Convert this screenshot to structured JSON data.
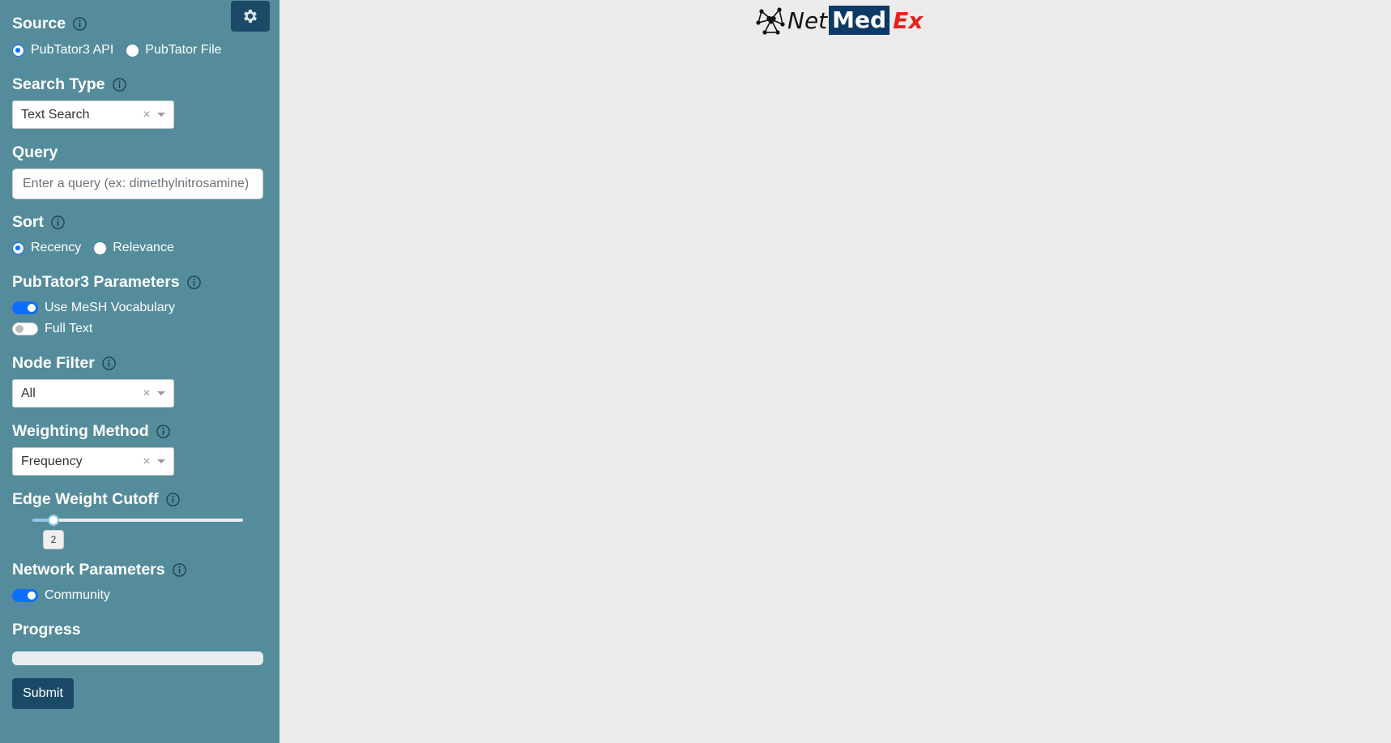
{
  "sidebar": {
    "source": {
      "title": "Source",
      "options": [
        {
          "label": "PubTator3 API",
          "selected": true
        },
        {
          "label": "PubTator File",
          "selected": false
        }
      ]
    },
    "search_type": {
      "title": "Search Type",
      "value": "Text Search"
    },
    "query": {
      "title": "Query",
      "placeholder": "Enter a query (ex: dimethylnitrosamine)",
      "value": ""
    },
    "sort": {
      "title": "Sort",
      "options": [
        {
          "label": "Recency",
          "selected": true
        },
        {
          "label": "Relevance",
          "selected": false
        }
      ]
    },
    "pubtator_params": {
      "title": "PubTator3 Parameters",
      "switches": [
        {
          "label": "Use MeSH Vocabulary",
          "on": true
        },
        {
          "label": "Full Text",
          "on": false
        }
      ]
    },
    "node_filter": {
      "title": "Node Filter",
      "value": "All"
    },
    "weighting_method": {
      "title": "Weighting Method",
      "value": "Frequency"
    },
    "edge_weight_cutoff": {
      "title": "Edge Weight Cutoff",
      "value": "2",
      "fraction": 0.1
    },
    "network_params": {
      "title": "Network Parameters",
      "switches": [
        {
          "label": "Community",
          "on": true
        }
      ]
    },
    "progress": {
      "title": "Progress",
      "percent": 0
    },
    "submit_label": "Submit"
  },
  "logo": {
    "net": "Net",
    "med": "Med",
    "ex": "Ex"
  },
  "icons": {
    "settings": "gear-icon",
    "info": "info-icon",
    "clear": "×"
  },
  "colors": {
    "sidebar_bg": "#548c9b",
    "button_bg": "#1b4a68",
    "accent": "#0d6efd",
    "logo_red": "#e0231c",
    "logo_navy": "#0b3a66"
  }
}
